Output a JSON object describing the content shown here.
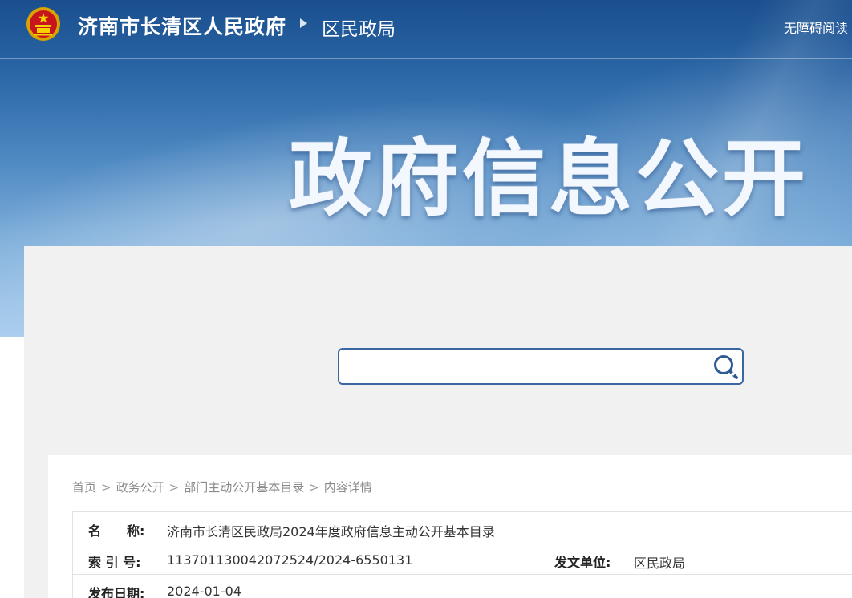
{
  "header": {
    "site_title": "济南市长清区人民政府",
    "dept_title": "区民政局",
    "accessibility_link": "无障碍阅读",
    "hero_title": "政府信息公开"
  },
  "search": {
    "placeholder": "",
    "value": ""
  },
  "breadcrumb": {
    "items": [
      "首页",
      "政务公开",
      "部门主动公开基本目录",
      "内容详情"
    ],
    "separator": ">"
  },
  "info": {
    "name_label": "名　　称:",
    "name_value": "济南市长清区民政局2024年度政府信息主动公开基本目录",
    "index_label": "索 引 号:",
    "index_value": "11370113004207252​4/2024-6550131",
    "issuer_label": "发文单位:",
    "issuer_value": "区民政局",
    "date_label": "发布日期:",
    "date_value": "2024-01-04"
  },
  "colors": {
    "banner_top": "#1a4f8e",
    "banner_bottom": "#a9cdee",
    "search_border": "#3a67a3",
    "panel_bg": "#f1f1f1"
  }
}
